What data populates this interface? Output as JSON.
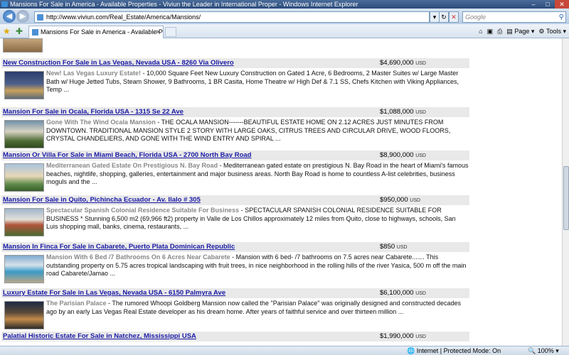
{
  "window": {
    "title": "Mansions For Sale in America - Available Properties - Viviun the Leader in International Proper - Windows Internet Explorer"
  },
  "address_bar": {
    "url": "http://www.viviun.com/Real_Estate/America/Mansions/"
  },
  "search": {
    "placeholder": "Google"
  },
  "tab": {
    "label": "Mansions For Sale in America - Available Properti..."
  },
  "commands": {
    "page": "Page",
    "tools": "Tools"
  },
  "listings": [
    {
      "title": "New Construction For Sale in Las Vegas, Nevada USA - 8260 Via Olivero",
      "price": "$4,690,000",
      "currency": "USD",
      "subtitle": "New! Las Vegas Luxury Estate!",
      "description": " - 10,000 Square Feet New Luxury Construction on Gated 1 Acre, 6 Bedrooms, 2 Master Suites w/ Large Master Bath w/ Huge Jetted Tubs, Steam Shower, 9 Bathrooms, 1 BR Casita, Home Theatre w/ High Def & 7.1 SS, Chefs Kitchen with Viking Appliances, Temp ..."
    },
    {
      "title": "Mansion For Sale in Ocala, Florida USA - 1315 Se 22 Ave",
      "price": "$1,088,000",
      "currency": "USD",
      "subtitle": "Gone With The Wind Ocala Mansion",
      "description": " - THE OCALA MANSION-------BEAUTIFUL ESTATE HOME ON 2.12 ACRES JUST MINUTES FROM DOWNTOWN. TRADITIONAL MANSION STYLE 2 STORY WITH LARGE OAKS, CITRUS TREES AND CIRCULAR DRIVE, WOOD FLOORS, CRYSTAL CHANDELIERS, AND GONE WITH THE WIND ENTRY AND SPIRAL ..."
    },
    {
      "title": "Mansion Or Villa For Sale in Miami Beach, Florida USA - 2700 North Bay Road",
      "price": "$8,900,000",
      "currency": "USD",
      "subtitle": "Mediterranean Gated Estate On Prestigious N. Bay Road",
      "description": " - Mediterranean gated estate on prestigious N. Bay Road in the heart of Miami's famous beaches, nightlife, shopping, galleries, entertainment and major business areas. North Bay Road is home to countless A-list celebrities, business moguls and the ..."
    },
    {
      "title": "Mansion For Sale in Quito, Pichincha Ecuador - Av. Ilalo # 305",
      "price": "$950,000",
      "currency": "USD",
      "subtitle": "Spectacular Spanish Colonial Residence Suitable For Business",
      "description": " - SPECTACULAR SPANISH COLONIAL RESIDENCE SUITABLE FOR BUSINESS * Stunning 6,500 m2 (69,966 ft2) property in Valle de Los Chillos approximately 12 miles from Quito, close to highways, schools, San Luis shopping mall, banks, cinema, restaurants, ..."
    },
    {
      "title": "Mansion In Finca For Sale in Cabarete, Puerto Plata Dominican Republic",
      "price": "$850",
      "currency": "USD",
      "subtitle": "Mansion With 6 Bed /7 Bathrooms On 6 Acres Near Cabarete",
      "description": " - Mansion with 6 bed- /7 bathrooms on 7.5 acres near Cabarete....... This outstanding property on 5.75 acres tropical landscaping with fruit trees, in nice neighborhood in the rolling hills of the river Yasica, 500 m off the main road Cabarete/Jamao ..."
    },
    {
      "title": "Luxury Estate For Sale in Las Vegas, Nevada USA - 6150 Palmyra Ave",
      "price": "$6,100,000",
      "currency": "USD",
      "subtitle": "The Parisian Palace",
      "description": " - The rumored Whoopi Goldberg Mansion now called the \"Parisian Palace\" was originally designed and constructed decades ago by an early Las Vegas Real Estate developer as his dream home. After years of faithful service and over thirteen million ..."
    },
    {
      "title": "Palatial Historic Estate For Sale in Natchez, Mississippi USA",
      "price": "$1,990,000",
      "currency": "USD",
      "subtitle": "",
      "description": ""
    }
  ],
  "status_bar": {
    "zone": "Internet | Protected Mode: On",
    "zoom": "100%"
  },
  "colors": {
    "link": "#1a1aa6",
    "header_bg": "#e9e9e9",
    "subtitle": "#888888"
  }
}
